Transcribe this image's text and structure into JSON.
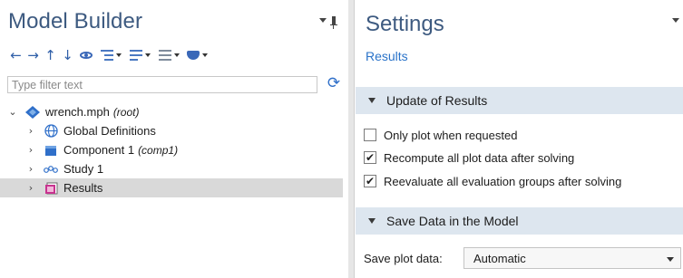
{
  "model_builder": {
    "title": "Model Builder",
    "filter_placeholder": "Type filter text",
    "toolbar": [
      "arrow-left-icon",
      "arrow-right-icon",
      "arrow-up-icon",
      "arrow-down-icon",
      "show-icon",
      "expand-icon",
      "collapse-icon",
      "layout-icon",
      "build-icon"
    ],
    "tree": [
      {
        "label": "wrench.mph",
        "sub": "(root)",
        "icon": "model-icon",
        "expanded": true
      },
      {
        "label": "Global Definitions",
        "sub": "",
        "icon": "globe-icon",
        "expanded": false
      },
      {
        "label": "Component 1",
        "sub": "(comp1)",
        "icon": "component-icon",
        "expanded": false
      },
      {
        "label": "Study 1",
        "sub": "",
        "icon": "study-icon",
        "expanded": false
      },
      {
        "label": "Results",
        "sub": "",
        "icon": "results-icon",
        "expanded": false,
        "selected": true
      }
    ]
  },
  "settings": {
    "title": "Settings",
    "subtitle": "Results",
    "section_update": "Update of Results",
    "checkboxes": [
      {
        "label": "Only plot when requested",
        "checked": false
      },
      {
        "label": "Recompute all plot data after solving",
        "checked": true
      },
      {
        "label": "Reevaluate all evaluation groups after solving",
        "checked": true
      }
    ],
    "section_save": "Save Data in the Model",
    "save_plot_label": "Save plot data:",
    "save_plot_value": "Automatic"
  },
  "colors": {
    "title_text": "#3d5a80",
    "subtitle_link": "#2a73c9",
    "section_bg": "#dde6ef",
    "selected_row": "#d9d9d9"
  }
}
